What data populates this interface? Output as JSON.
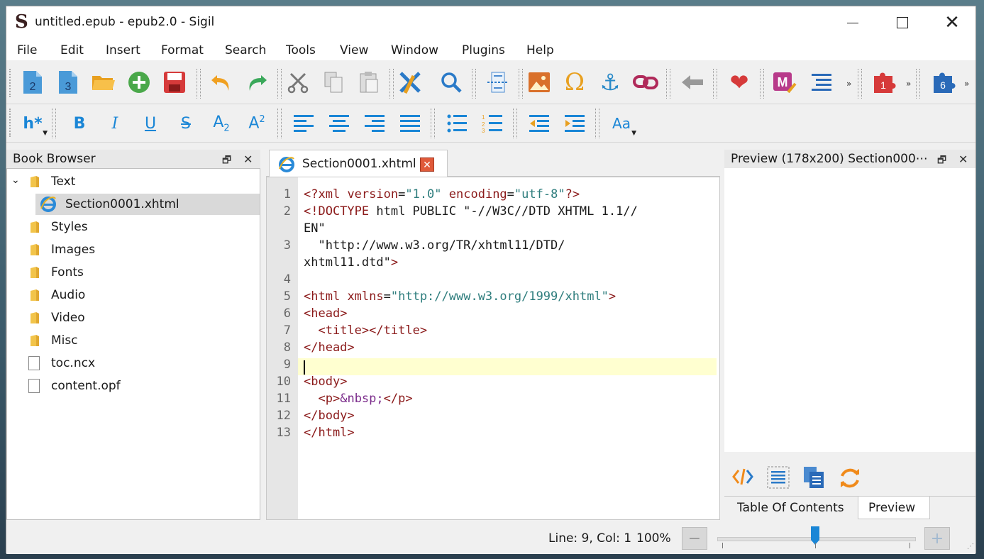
{
  "window": {
    "title": "untitled.epub - epub2.0 - Sigil",
    "app_icon_letter": "S"
  },
  "menu": [
    "File",
    "Edit",
    "Insert",
    "Format",
    "Search",
    "Tools",
    "View",
    "Window",
    "Plugins",
    "Help"
  ],
  "toolbar": {
    "new_epub2_label": "2",
    "new_epub3_label": "3",
    "heading_label": "h*",
    "bold_label": "B",
    "italic_label": "I",
    "underline_label": "U",
    "strike_label": "S",
    "subscript_label": "A",
    "subscript_sub": "2",
    "superscript_label": "A",
    "superscript_sup": "2",
    "case_label": "Aa",
    "plugin_1_label": "1",
    "plugin_6_label": "6"
  },
  "book_browser": {
    "title": "Book Browser",
    "items": [
      {
        "label": "Text",
        "type": "folder",
        "expanded": true
      },
      {
        "label": "Section0001.xhtml",
        "type": "xhtml",
        "selected": true
      },
      {
        "label": "Styles",
        "type": "folder"
      },
      {
        "label": "Images",
        "type": "folder"
      },
      {
        "label": "Fonts",
        "type": "folder"
      },
      {
        "label": "Audio",
        "type": "folder"
      },
      {
        "label": "Video",
        "type": "folder"
      },
      {
        "label": "Misc",
        "type": "folder"
      },
      {
        "label": "toc.ncx",
        "type": "file"
      },
      {
        "label": "content.opf",
        "type": "file"
      }
    ]
  },
  "editor": {
    "tab_label": "Section0001.xhtml",
    "line_numbers": [
      "1",
      "2",
      "",
      "3",
      "",
      "4",
      "5",
      "6",
      "7",
      "8",
      "9",
      "10",
      "11",
      "12",
      "13"
    ],
    "lines": [
      "<?xml version=\"1.0\" encoding=\"utf-8\"?>",
      "<!DOCTYPE html PUBLIC \"-//W3C//DTD XHTML 1.1//",
      "EN\"",
      "  \"http://www.w3.org/TR/xhtml11/DTD/",
      "xhtml11.dtd\">",
      "",
      "<html xmlns=\"http://www.w3.org/1999/xhtml\">",
      "<head>",
      "  <title></title>",
      "</head>",
      "",
      "<body>",
      "  <p>&nbsp;</p>",
      "</body>",
      "</html>"
    ]
  },
  "preview": {
    "title": "Preview (178x200) Section000⋯",
    "tabs": [
      "Table Of Contents",
      "Preview"
    ],
    "active_tab": "Preview"
  },
  "status": {
    "position": "Line: 9, Col: 1",
    "zoom": "100%",
    "zoom_minus": "−",
    "zoom_plus": "+"
  },
  "colors": {
    "accent_blue": "#1a86d6",
    "icon_red": "#d63a2a",
    "icon_orange": "#f08a1a",
    "current_line": "#ffffd0"
  }
}
